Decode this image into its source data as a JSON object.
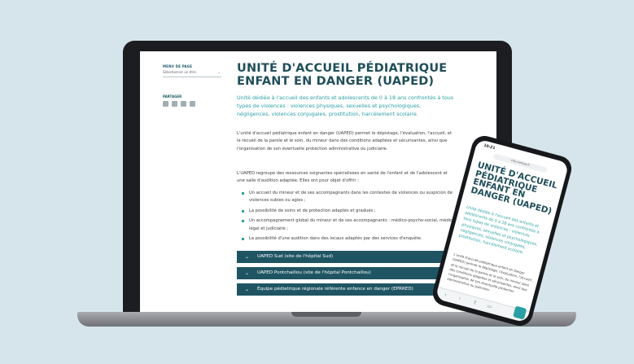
{
  "desktop": {
    "menu_label": "MENU DE PAGE",
    "menu_select": "Sélectionner un titre",
    "share_label": "PARTAGER",
    "title": "UNITÉ D'ACCUEIL PÉDIATRIQUE ENFANT EN DANGER (UAPED)",
    "lead": "Unité dédiée à l'accueil des enfants et adolescents de 0 à 18 ans confrontés à tous types de violences : violences physiques, sexuelles et psychologiques, négligences, violences conjugales, prostitution, harcèlement scolaire.",
    "para1": "L'unité d'accueil pédiatrique enfant en danger (UAPED) permet le dépistage, l'évaluation, l'accueil, et le recueil de la parole et le soin, du mineur dans des conditions adaptées et sécurisantes, ainsi que l'organisation de son éventuelle protection administrative ou judiciaire.",
    "para2": "L'UAPED regroupe des ressources soignantes spécialisées en santé de l'enfant et de l'adolescent et une salle d'audition adaptée. Elles ont pour objet d'offrir :",
    "bullets": [
      "Un accueil du mineur et de ses accompagnants dans les contextes de violences ou suspicion de violences subies ou agies ;",
      "La possibilité de soins et de protection adaptés et gradués ;",
      "Un accompagnement global du mineur et de ses accompagnants : médico-psycho-social, médico-légal et judiciaire ;",
      "La possibilité d'une audition dans des locaux adaptés par des services d'enquête."
    ],
    "accordions": [
      "UAPED Sud (site de l'hôpital Sud)",
      "UAPED Pontchaillou (site de l'hôpital Pontchaillou)",
      "Équipe pédiatrique régionale référente enfance en danger (EPRRED)"
    ]
  },
  "mobile": {
    "status_time": "10:21",
    "url": "chu-rennes.fr",
    "title": "UNITÉ D'ACCUEIL PÉDIATRIQUE ENFANT EN DANGER (UAPED)",
    "lead": "Unité dédiée à l'accueil des enfants et adolescents de 0 à 18 ans confrontés à tous types de violences : violences physiques, sexuelles et psychologiques, négligences, violences conjugales, prostitution, harcèlement scolaire.",
    "para": "L'unité d'accueil pédiatrique enfant en danger (UAPED) permet le dépistage, l'évaluation, l'accueil, et le recueil de la parole et le soin, du mineur dans des conditions adaptées et sécurisantes, ainsi que l'organisation de son éventuelle protection administrative ou judiciaire."
  },
  "icons": {
    "share": [
      "print-icon",
      "facebook-icon",
      "mail-icon",
      "share-icon"
    ],
    "accordion": "chevron-down-icon"
  },
  "colors": {
    "background": "#d5e5eb",
    "title": "#1f4e5a",
    "accent": "#2aa0a4",
    "accordion": "#1f5563"
  }
}
